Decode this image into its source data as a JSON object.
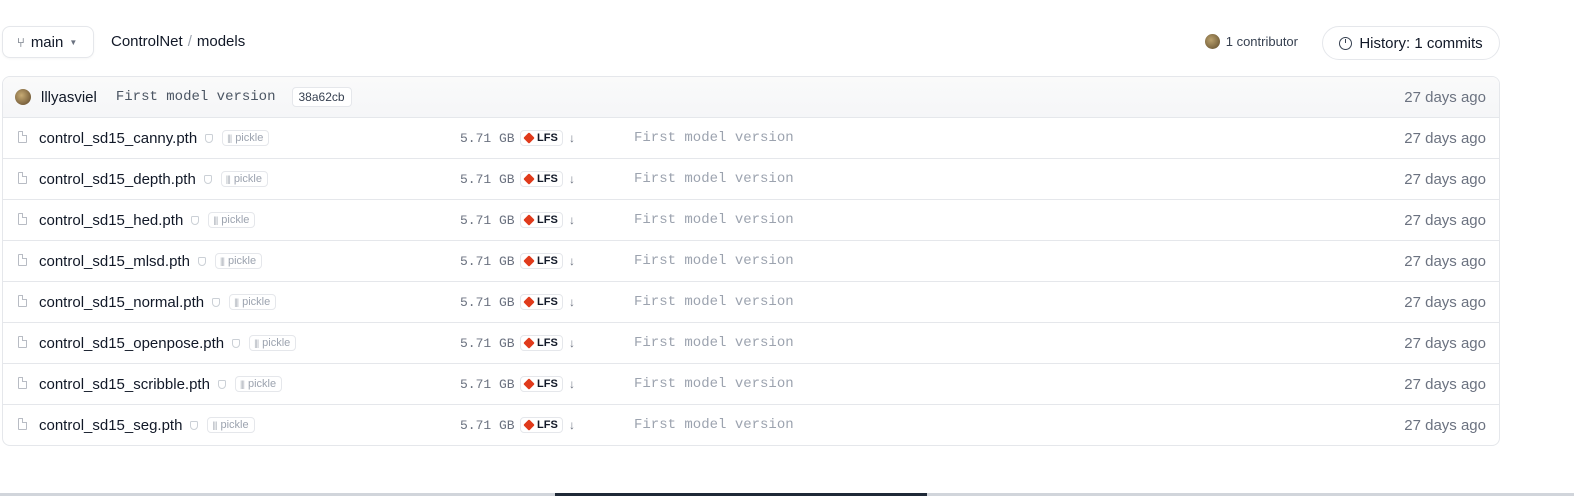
{
  "header": {
    "branch_label": "main",
    "breadcrumb": [
      "ControlNet",
      "models"
    ],
    "breadcrumb_sep": "/",
    "contributors": "1 contributor",
    "history": "History: 1 commits"
  },
  "last_commit": {
    "author": "lllyasviel",
    "message": "First model version",
    "sha": "38a62cb",
    "date": "27 days ago"
  },
  "files": [
    {
      "name": "control_sd15_canny.pth",
      "badge": "pickle",
      "size": "5.71 GB",
      "lfs": "LFS",
      "message": "First model version",
      "date": "27 days ago"
    },
    {
      "name": "control_sd15_depth.pth",
      "badge": "pickle",
      "size": "5.71 GB",
      "lfs": "LFS",
      "message": "First model version",
      "date": "27 days ago"
    },
    {
      "name": "control_sd15_hed.pth",
      "badge": "pickle",
      "size": "5.71 GB",
      "lfs": "LFS",
      "message": "First model version",
      "date": "27 days ago"
    },
    {
      "name": "control_sd15_mlsd.pth",
      "badge": "pickle",
      "size": "5.71 GB",
      "lfs": "LFS",
      "message": "First model version",
      "date": "27 days ago"
    },
    {
      "name": "control_sd15_normal.pth",
      "badge": "pickle",
      "size": "5.71 GB",
      "lfs": "LFS",
      "message": "First model version",
      "date": "27 days ago"
    },
    {
      "name": "control_sd15_openpose.pth",
      "badge": "pickle",
      "size": "5.71 GB",
      "lfs": "LFS",
      "message": "First model version",
      "date": "27 days ago"
    },
    {
      "name": "control_sd15_scribble.pth",
      "badge": "pickle",
      "size": "5.71 GB",
      "lfs": "LFS",
      "message": "First model version",
      "date": "27 days ago"
    },
    {
      "name": "control_sd15_seg.pth",
      "badge": "pickle",
      "size": "5.71 GB",
      "lfs": "LFS",
      "message": "First model version",
      "date": "27 days ago"
    }
  ],
  "icons": {
    "branch": "git-branch-icon",
    "caret": "chevron-down-icon",
    "clock": "clock-icon",
    "file": "file-icon",
    "shield": "shield-icon",
    "lfs": "lfs-cube-icon",
    "download": "download-arrow-icon"
  },
  "colors": {
    "lfs_accent": "#e03a1b",
    "border": "#e5e7eb",
    "muted_text": "#6b7280"
  }
}
